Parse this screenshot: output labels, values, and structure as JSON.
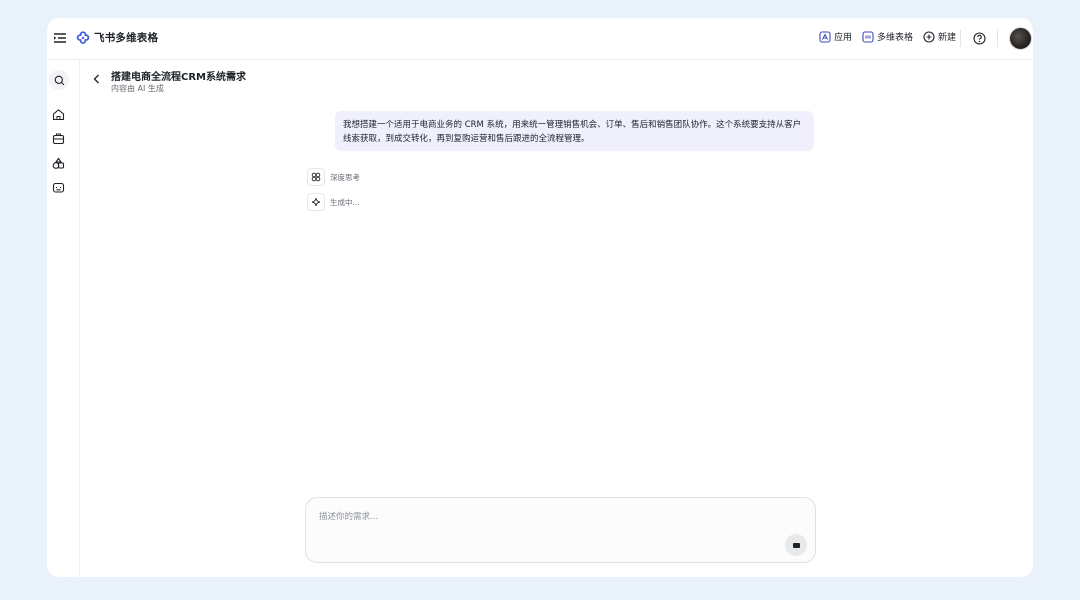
{
  "app": {
    "name": "飞书多维表格"
  },
  "topbar": {
    "apps_label": "应用",
    "bitable_label": "多维表格",
    "new_label": "新建"
  },
  "document": {
    "title": "搭建电商全流程CRM系统需求",
    "subtitle": "内容由 AI 生成"
  },
  "conversation": {
    "user_message": "我想搭建一个适用于电商业务的 CRM 系统，用来统一管理销售机会、订单、售后和销售团队协作。这个系统要支持从客户线索获取，到成交转化，再到复购运营和售后跟进的全流程管理。",
    "steps": [
      {
        "label": "深度思考",
        "icon": "deep-think-icon"
      },
      {
        "label": "生成中...",
        "icon": "sparkle-icon"
      }
    ]
  },
  "composer": {
    "placeholder": "描述你的需求...",
    "value": ""
  },
  "colors": {
    "page_background": "#e9f1fb",
    "bubble_background": "#f0f0fd",
    "brand_accent": "#3b5bdb"
  }
}
